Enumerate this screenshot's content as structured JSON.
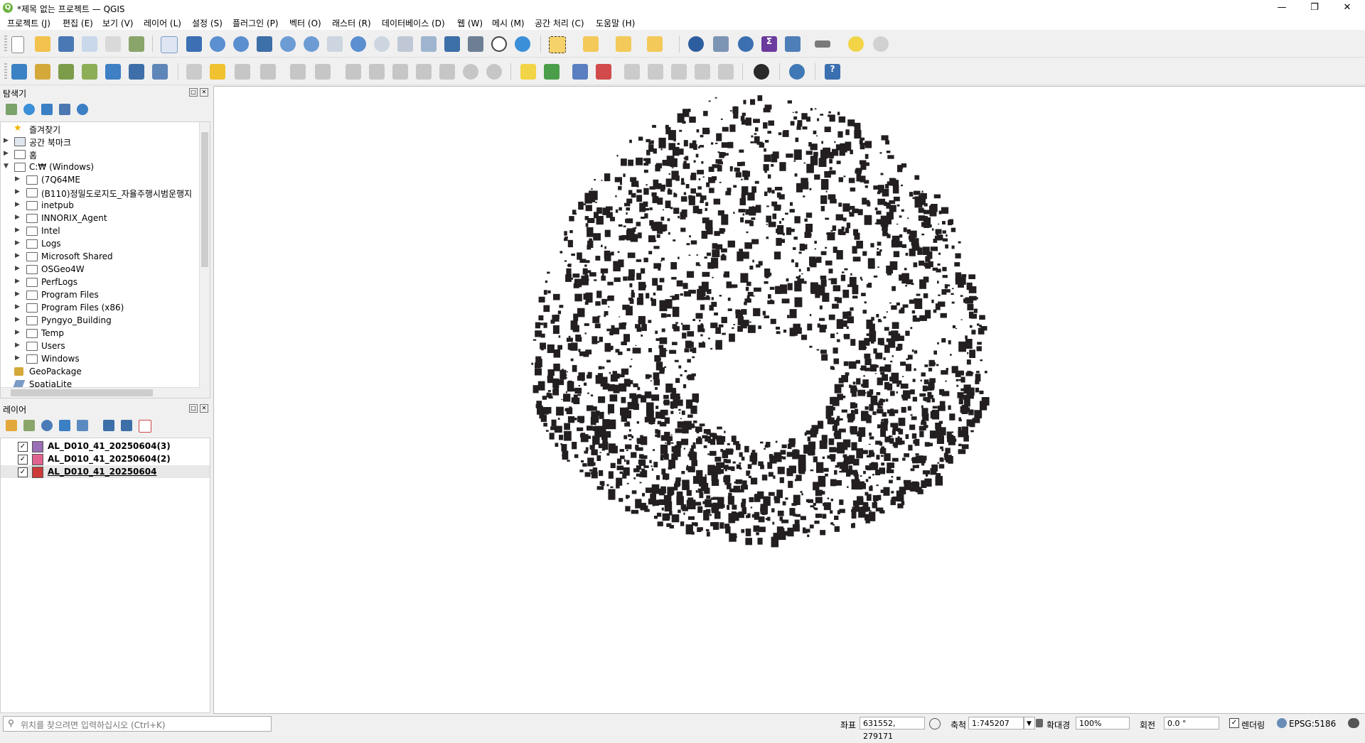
{
  "window": {
    "title": "*제목 없는 프로젝트 — QGIS"
  },
  "menu": [
    "프로젝트 (J)",
    "편집 (E)",
    "보기 (V)",
    "레이어 (L)",
    "설정 (S)",
    "플러그인 (P)",
    "벡터 (O)",
    "래스터 (R)",
    "데이터베이스 (D)",
    "웹 (W)",
    "메시 (M)",
    "공간 처리 (C)",
    "도움말 (H)"
  ],
  "browser": {
    "title": "탐색기",
    "items": [
      {
        "label": "즐겨찾기",
        "level": 0,
        "expander": "",
        "icon": "star-icon"
      },
      {
        "label": "공간 북마크",
        "level": 0,
        "expander": "▶",
        "icon": "bookmark-icon"
      },
      {
        "label": "홈",
        "level": 0,
        "expander": "▶",
        "icon": "home-icon"
      },
      {
        "label": "C:₩ (Windows)",
        "level": 0,
        "expander": "▼",
        "icon": "drive-icon"
      },
      {
        "label": "(7Q64ME",
        "level": 1,
        "expander": "▶",
        "icon": "folder-icon"
      },
      {
        "label": "(B110)정밀도로지도_자율주행시범운행지",
        "level": 1,
        "expander": "▶",
        "icon": "folder-icon"
      },
      {
        "label": "inetpub",
        "level": 1,
        "expander": "▶",
        "icon": "folder-icon"
      },
      {
        "label": "INNORIX_Agent",
        "level": 1,
        "expander": "▶",
        "icon": "folder-icon"
      },
      {
        "label": "Intel",
        "level": 1,
        "expander": "▶",
        "icon": "folder-icon"
      },
      {
        "label": "Logs",
        "level": 1,
        "expander": "▶",
        "icon": "folder-icon"
      },
      {
        "label": "Microsoft Shared",
        "level": 1,
        "expander": "▶",
        "icon": "folder-icon"
      },
      {
        "label": "OSGeo4W",
        "level": 1,
        "expander": "▶",
        "icon": "folder-icon"
      },
      {
        "label": "PerfLogs",
        "level": 1,
        "expander": "▶",
        "icon": "folder-icon"
      },
      {
        "label": "Program Files",
        "level": 1,
        "expander": "▶",
        "icon": "folder-icon"
      },
      {
        "label": "Program Files (x86)",
        "level": 1,
        "expander": "▶",
        "icon": "folder-icon"
      },
      {
        "label": "Pyngyo_Building",
        "level": 1,
        "expander": "▶",
        "icon": "folder-icon"
      },
      {
        "label": "Temp",
        "level": 1,
        "expander": "▶",
        "icon": "folder-icon"
      },
      {
        "label": "Users",
        "level": 1,
        "expander": "▶",
        "icon": "folder-icon"
      },
      {
        "label": "Windows",
        "level": 1,
        "expander": "▶",
        "icon": "folder-icon"
      },
      {
        "label": "GeoPackage",
        "level": 0,
        "expander": "",
        "icon": "geopackage-icon"
      },
      {
        "label": "SpatiaLite",
        "level": 0,
        "expander": "",
        "icon": "spatialite-icon"
      }
    ]
  },
  "layers": {
    "title": "레이어",
    "items": [
      {
        "label": "AL_D010_41_20250604(3)",
        "checked": true,
        "color": "#9b6fb5",
        "selected": false
      },
      {
        "label": "AL_D010_41_20250604(2)",
        "checked": true,
        "color": "#e0628e",
        "selected": false
      },
      {
        "label": "AL_D010_41_20250604",
        "checked": true,
        "color": "#cc3a3a",
        "selected": true
      }
    ]
  },
  "status": {
    "locator_placeholder": "위치를 찾으려면 입력하십시오 (Ctrl+K)",
    "coord_label": "좌표",
    "coord_value": "631552, 279171",
    "scale_label": "축척",
    "scale_value": "1:745207",
    "magnifier_label": "확대경",
    "magnifier_value": "100%",
    "rotation_label": "회전",
    "rotation_value": "0.0 °",
    "render_label": "렌더링",
    "crs": "EPSG:5186"
  },
  "map": {
    "feature_color": "#231f20"
  }
}
